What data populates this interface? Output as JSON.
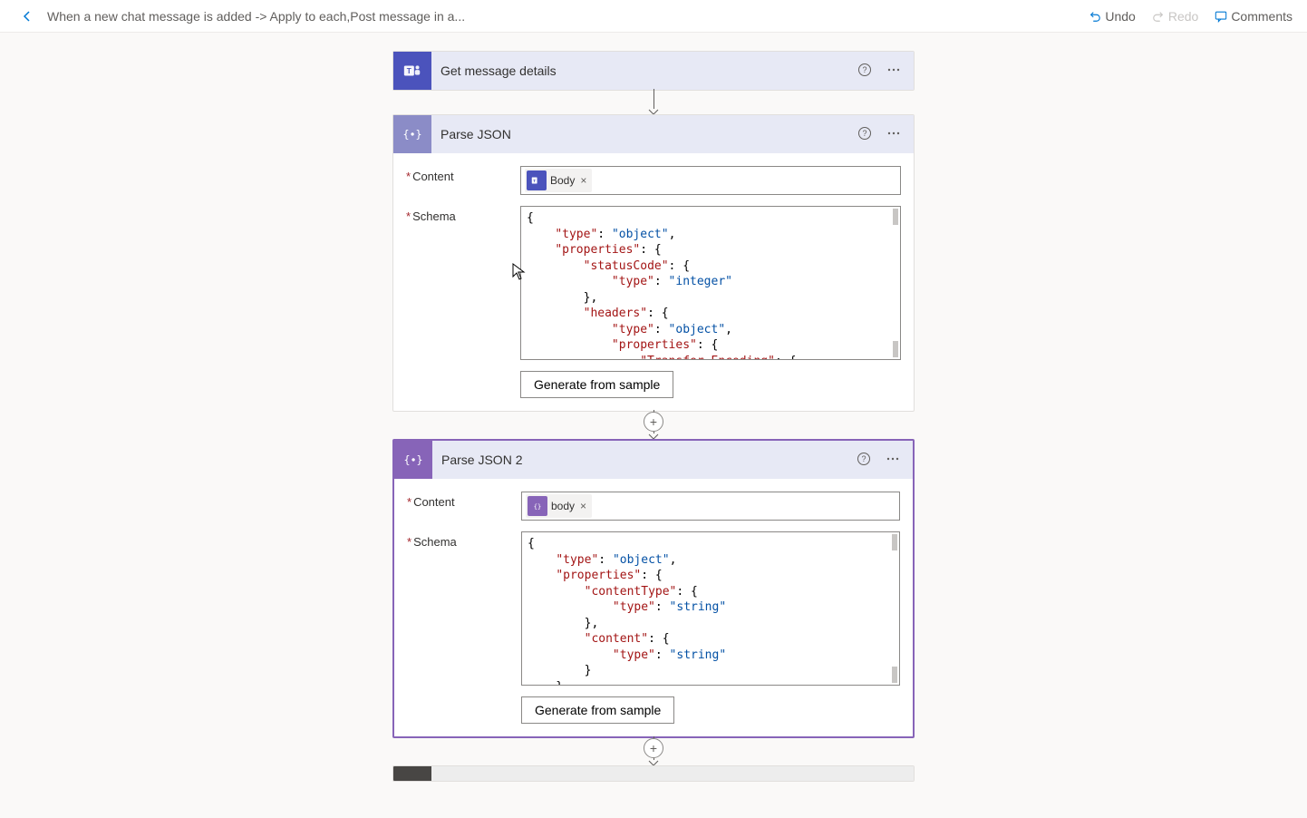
{
  "toolbar": {
    "breadcrumb": "When a new chat message is added -> Apply to each,Post message in a...",
    "undo": "Undo",
    "redo": "Redo",
    "comments": "Comments"
  },
  "card1": {
    "title": "Get message details"
  },
  "card2": {
    "title": "Parse JSON",
    "content_label": "Content",
    "schema_label": "Schema",
    "token_label": "Body",
    "gen_label": "Generate from sample",
    "schema_lines": [
      [
        {
          "t": "p",
          "v": "{"
        }
      ],
      [
        {
          "t": "p",
          "v": "    "
        },
        {
          "t": "k",
          "v": "\"type\""
        },
        {
          "t": "p",
          "v": ": "
        },
        {
          "t": "s",
          "v": "\"object\""
        },
        {
          "t": "p",
          "v": ","
        }
      ],
      [
        {
          "t": "p",
          "v": "    "
        },
        {
          "t": "k",
          "v": "\"properties\""
        },
        {
          "t": "p",
          "v": ": {"
        }
      ],
      [
        {
          "t": "p",
          "v": "        "
        },
        {
          "t": "k",
          "v": "\"statusCode\""
        },
        {
          "t": "p",
          "v": ": {"
        }
      ],
      [
        {
          "t": "p",
          "v": "            "
        },
        {
          "t": "k",
          "v": "\"type\""
        },
        {
          "t": "p",
          "v": ": "
        },
        {
          "t": "s",
          "v": "\"integer\""
        }
      ],
      [
        {
          "t": "p",
          "v": "        },"
        }
      ],
      [
        {
          "t": "p",
          "v": "        "
        },
        {
          "t": "k",
          "v": "\"headers\""
        },
        {
          "t": "p",
          "v": ": {"
        }
      ],
      [
        {
          "t": "p",
          "v": "            "
        },
        {
          "t": "k",
          "v": "\"type\""
        },
        {
          "t": "p",
          "v": ": "
        },
        {
          "t": "s",
          "v": "\"object\""
        },
        {
          "t": "p",
          "v": ","
        }
      ],
      [
        {
          "t": "p",
          "v": "            "
        },
        {
          "t": "k",
          "v": "\"properties\""
        },
        {
          "t": "p",
          "v": ": {"
        }
      ],
      [
        {
          "t": "p",
          "v": "                "
        },
        {
          "t": "k",
          "v": "\"Transfer-Encoding\""
        },
        {
          "t": "p",
          "v": ": {"
        }
      ]
    ]
  },
  "card3": {
    "title": "Parse JSON 2",
    "content_label": "Content",
    "schema_label": "Schema",
    "token_label": "body",
    "gen_label": "Generate from sample",
    "schema_lines": [
      [
        {
          "t": "p",
          "v": "{"
        }
      ],
      [
        {
          "t": "p",
          "v": "    "
        },
        {
          "t": "k",
          "v": "\"type\""
        },
        {
          "t": "p",
          "v": ": "
        },
        {
          "t": "s",
          "v": "\"object\""
        },
        {
          "t": "p",
          "v": ","
        }
      ],
      [
        {
          "t": "p",
          "v": "    "
        },
        {
          "t": "k",
          "v": "\"properties\""
        },
        {
          "t": "p",
          "v": ": {"
        }
      ],
      [
        {
          "t": "p",
          "v": "        "
        },
        {
          "t": "k",
          "v": "\"contentType\""
        },
        {
          "t": "p",
          "v": ": {"
        }
      ],
      [
        {
          "t": "p",
          "v": "            "
        },
        {
          "t": "k",
          "v": "\"type\""
        },
        {
          "t": "p",
          "v": ": "
        },
        {
          "t": "s",
          "v": "\"string\""
        }
      ],
      [
        {
          "t": "p",
          "v": "        },"
        }
      ],
      [
        {
          "t": "p",
          "v": "        "
        },
        {
          "t": "k",
          "v": "\"content\""
        },
        {
          "t": "p",
          "v": ": {"
        }
      ],
      [
        {
          "t": "p",
          "v": "            "
        },
        {
          "t": "k",
          "v": "\"type\""
        },
        {
          "t": "p",
          "v": ": "
        },
        {
          "t": "s",
          "v": "\"string\""
        }
      ],
      [
        {
          "t": "p",
          "v": "        }"
        }
      ],
      [
        {
          "t": "p",
          "v": "    }"
        }
      ]
    ]
  }
}
